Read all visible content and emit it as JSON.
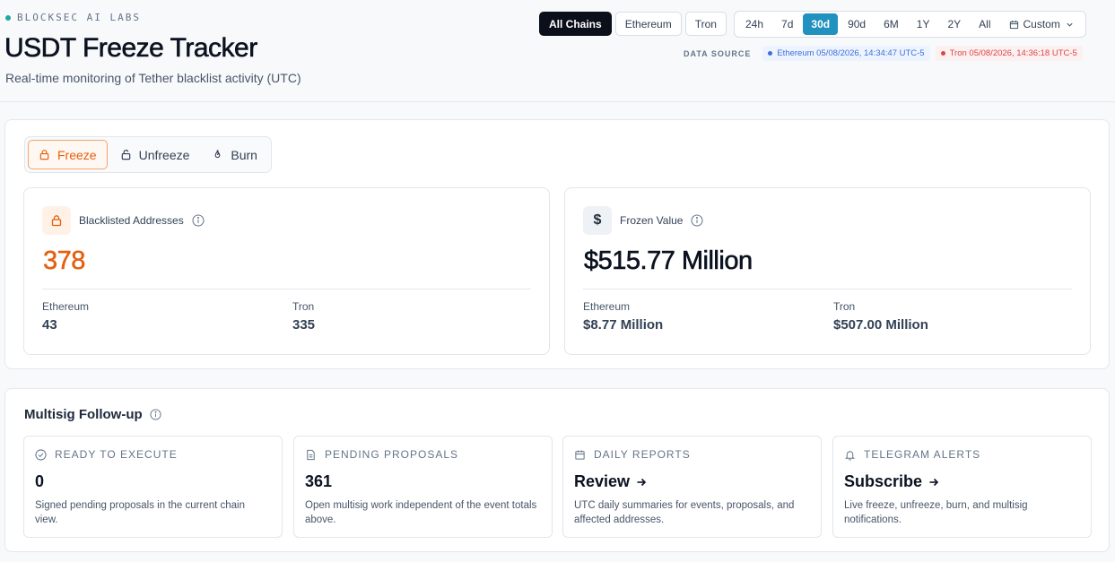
{
  "header": {
    "brand": "BLOCKSEC AI LABS",
    "title": "USDT Freeze Tracker",
    "subtitle": "Real-time monitoring of Tether blacklist activity (UTC)"
  },
  "chains": [
    "All Chains",
    "Ethereum",
    "Tron"
  ],
  "active_chain": "All Chains",
  "ranges": [
    "24h",
    "7d",
    "30d",
    "90d",
    "6M",
    "1Y",
    "2Y",
    "All"
  ],
  "active_range": "30d",
  "custom_label": "Custom",
  "data_source": {
    "label": "DATA SOURCE",
    "ethereum": "Ethereum 05/08/2026, 14:34:47 UTC-5",
    "tron": "Tron 05/08/2026, 14:36:18 UTC-5"
  },
  "tabs": {
    "freeze": "Freeze",
    "unfreeze": "Unfreeze",
    "burn": "Burn"
  },
  "blacklisted": {
    "label": "Blacklisted Addresses",
    "value": "378",
    "ethereum_label": "Ethereum",
    "ethereum_value": "43",
    "tron_label": "Tron",
    "tron_value": "335"
  },
  "frozen": {
    "label": "Frozen Value",
    "icon_symbol": "$",
    "value": "$515.77 Million",
    "ethereum_label": "Ethereum",
    "ethereum_value": "$8.77 Million",
    "tron_label": "Tron",
    "tron_value": "$507.00 Million"
  },
  "multisig": {
    "title": "Multisig Follow-up",
    "cards": [
      {
        "icon": "check-circle-icon",
        "label": "READY TO EXECUTE",
        "value": "0",
        "desc": "Signed pending proposals in the current chain view."
      },
      {
        "icon": "document-icon",
        "label": "PENDING PROPOSALS",
        "value": "361",
        "desc": "Open multisig work independent of the event totals above."
      },
      {
        "icon": "calendar-icon",
        "label": "DAILY REPORTS",
        "value": "Review",
        "desc": "UTC daily summaries for events, proposals, and affected addresses."
      },
      {
        "icon": "bell-icon",
        "label": "TELEGRAM ALERTS",
        "value": "Subscribe",
        "desc": "Live freeze, unfreeze, burn, and multisig notifications."
      }
    ]
  },
  "colors": {
    "accent_orange": "#e4600f",
    "accent_blue": "#2191c0",
    "ethereum": "#3b6fd6",
    "tron": "#d94848"
  }
}
